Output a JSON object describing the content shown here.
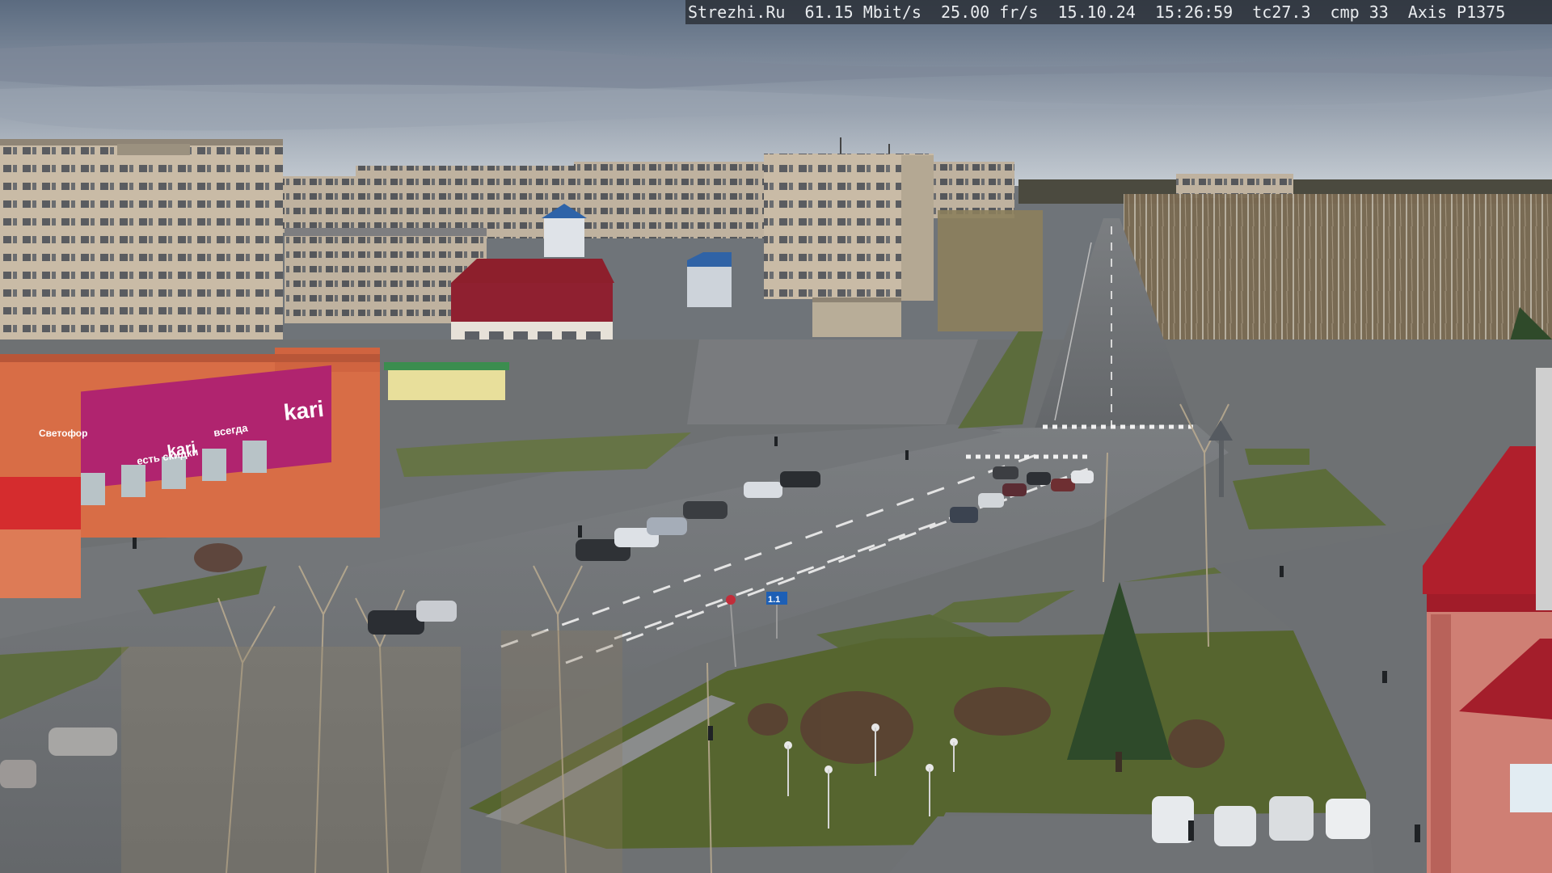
{
  "overlay": {
    "site": "Strezhi.Ru",
    "bitrate": "61.15 Mbit/s",
    "fps": "25.00 fr/s",
    "date": "15.10.24",
    "time": "15:26:59",
    "tc": "tc27.3",
    "cmp": "cmp 33",
    "camera": "Axis P1375"
  },
  "signs": {
    "kari_logo": "kari",
    "kari_tagline": "есть скидки",
    "kari_tagline2": "всегда",
    "kari_tagline3": "kari",
    "shop_small": "Светофор",
    "road_sign": "1.1"
  },
  "colors": {
    "sky_top": "#5f6f84",
    "sky_bottom": "#b9c2cc",
    "road": "#6d7073",
    "grass": "#5b6a3a",
    "kari": "#b0246f",
    "roof_red": "#b3202b"
  }
}
